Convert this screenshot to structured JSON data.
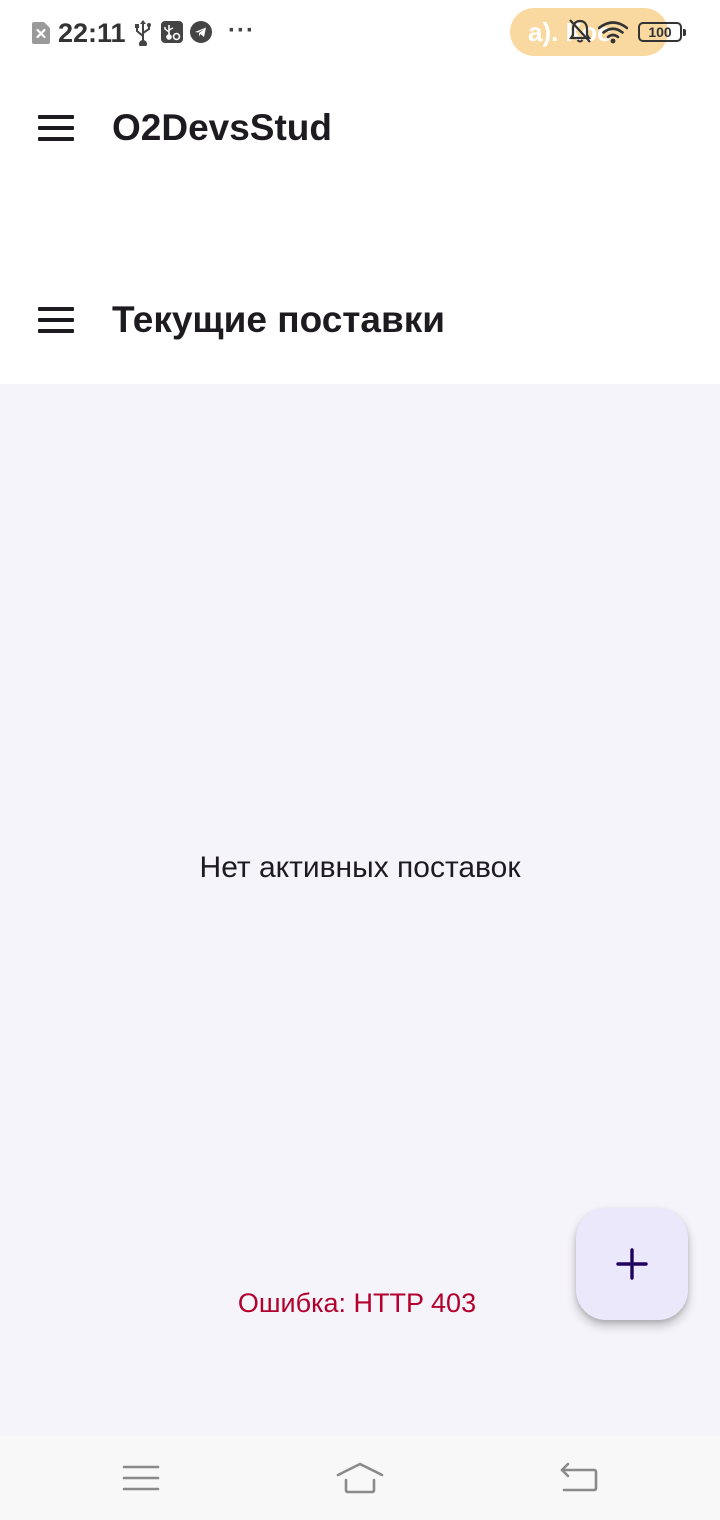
{
  "status_bar": {
    "time": "22:11",
    "more": "···",
    "pill_text": "а). Кос",
    "battery": "100",
    "icons": [
      "sim-error-icon",
      "usb-icon",
      "usb-settings-icon",
      "telegram-icon",
      "bell-off-icon",
      "wifi-icon",
      "battery-icon"
    ],
    "pill_color": "#f9d9a0"
  },
  "app_bar": {
    "title": "O2DevsStud",
    "menu_icon": "hamburger-menu-icon"
  },
  "page_header": {
    "title": "Текущие поставки",
    "menu_icon": "hamburger-menu-icon"
  },
  "main": {
    "empty_message": "Нет активных поставок",
    "error_message": "Ошибка: HTTP 403",
    "background": "#f5f4fa"
  },
  "fab": {
    "icon": "plus-icon",
    "background": "#ebe8fb",
    "icon_color": "#21005d"
  },
  "nav_bar": {
    "buttons": [
      "recent-apps-icon",
      "home-icon",
      "back-icon"
    ]
  },
  "colors": {
    "text_primary": "#1d1b20",
    "error": "#b3002d"
  }
}
